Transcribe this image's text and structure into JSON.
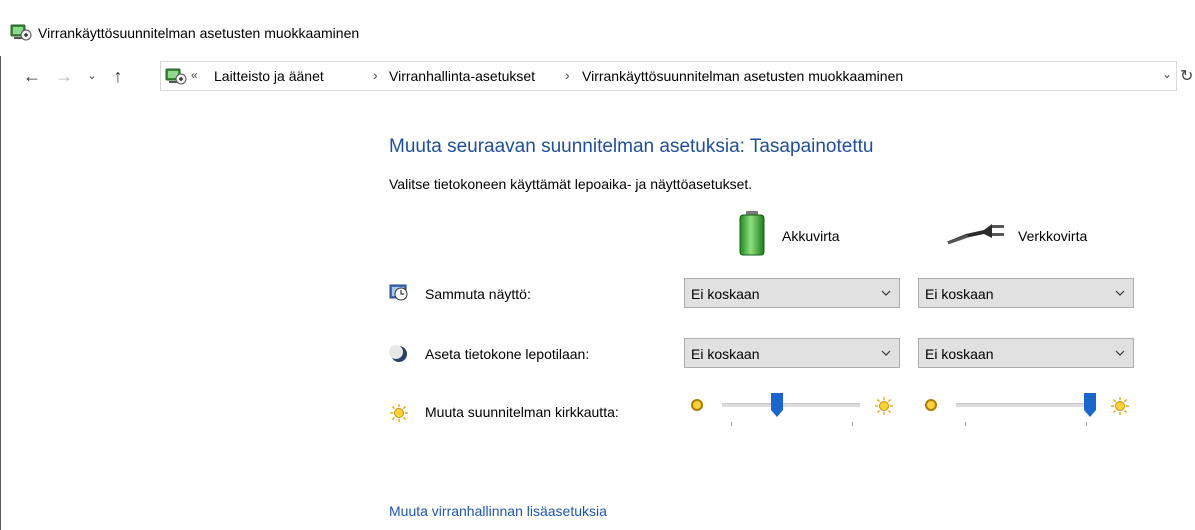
{
  "window": {
    "title": "Virrankäyttösuunnitelman asetusten muokkaaminen"
  },
  "navigation": {
    "back_glyph": "←",
    "forward_glyph": "→",
    "recent_glyph": "⌄",
    "up_glyph": "↑",
    "overflow_glyph": "«",
    "breadcrumbs": [
      "Laitteisto ja äänet",
      "Virranhallinta-asetukset",
      "Virrankäyttösuunnitelman asetusten muokkaaminen"
    ],
    "separator": "›",
    "dropdown_glyph": "⌄",
    "refresh_glyph": "↻"
  },
  "main": {
    "heading": "Muuta seuraavan suunnitelman asetuksia: Tasapainotettu",
    "subheading": "Valitse tietokoneen käyttämät lepoaika- ja näyttöasetukset.",
    "columns": {
      "battery": {
        "label": "Akkuvirta",
        "icon": "battery-icon"
      },
      "plugged": {
        "label": "Verkkovirta",
        "icon": "power-plug-icon"
      }
    },
    "rows": [
      {
        "label": "Sammuta näyttö:",
        "icon": "monitor-clock-icon",
        "battery_value": "Ei koskaan",
        "plugged_value": "Ei koskaan"
      },
      {
        "label": "Aseta tietokone lepotilaan:",
        "icon": "sleep-moon-icon",
        "battery_value": "Ei koskaan",
        "plugged_value": "Ei koskaan"
      }
    ],
    "brightness": {
      "label": "Muuta suunnitelman kirkkautta:",
      "icon": "brightness-sun-icon",
      "battery_level": 0.4,
      "plugged_level": 0.97
    },
    "link": "Muuta virranhallinnan lisäasetuksia"
  },
  "colors": {
    "heading": "#1e4e9c",
    "link": "#1e55b3",
    "slider_thumb": "#1a66cc",
    "select_bg": "#e1e1e1"
  }
}
